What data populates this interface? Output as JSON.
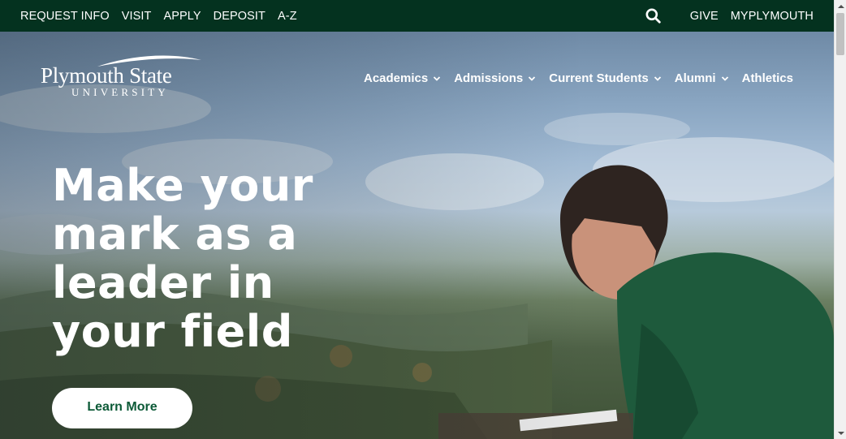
{
  "utility_nav": {
    "left_links": [
      "REQUEST INFO",
      "VISIT",
      "APPLY",
      "DEPOSIT",
      "A-Z"
    ],
    "search_icon": "search-icon",
    "right_links": [
      "GIVE",
      "MYPLYMOUTH"
    ]
  },
  "logo": {
    "name": "Plymouth State",
    "sub": "UNIVERSITY"
  },
  "main_nav": {
    "items": [
      {
        "label": "Academics",
        "has_dropdown": true
      },
      {
        "label": "Admissions",
        "has_dropdown": true
      },
      {
        "label": "Current Students",
        "has_dropdown": true
      },
      {
        "label": "Alumni",
        "has_dropdown": true
      },
      {
        "label": "Athletics",
        "has_dropdown": false
      }
    ]
  },
  "hero": {
    "headline_lines": [
      "Make your",
      "mark as a",
      "leader in",
      "your field"
    ],
    "cta_label": "Learn More"
  },
  "colors": {
    "utility_bg": "#04321f",
    "cta_text": "#0c5a37",
    "text": "#ffffff"
  }
}
